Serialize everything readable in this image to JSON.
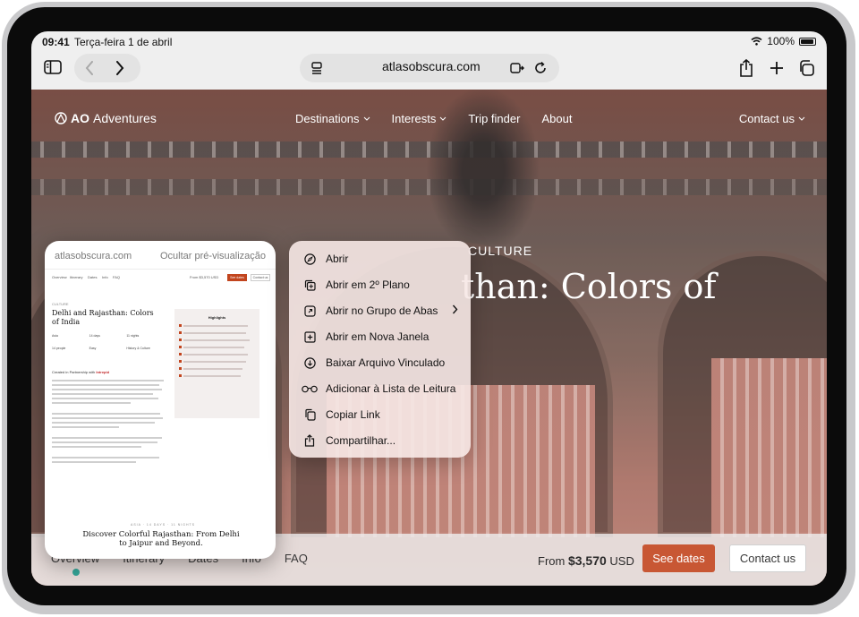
{
  "status_bar": {
    "time": "09:41",
    "date": "Terça-feira 1 de abril",
    "battery": "100%"
  },
  "toolbar": {
    "url": "atlasobscura.com",
    "icons": [
      "sidebar-icon",
      "back-icon",
      "forward-icon",
      "page-menu-icon",
      "reader-icon",
      "reload-icon",
      "share-icon",
      "new-tab-icon",
      "tabs-overview-icon"
    ]
  },
  "site": {
    "logo_bold": "AO",
    "logo_rest": "Adventures",
    "nav": [
      {
        "label": "Destinations",
        "dropdown": true
      },
      {
        "label": "Interests",
        "dropdown": true
      },
      {
        "label": "Trip finder",
        "dropdown": false
      },
      {
        "label": "About",
        "dropdown": false
      }
    ],
    "contact": "Contact us",
    "hero_kicker": "CULTURE",
    "hero_title": "than: Colors of",
    "bottom": {
      "tabs": [
        "Overview",
        "Itinerary",
        "Dates",
        "Info",
        "FAQ"
      ],
      "price_prefix": "From",
      "price_value": "$3,570",
      "price_currency": "USD",
      "see_dates": "See dates",
      "contact": "Contact us"
    }
  },
  "preview": {
    "url": "atlasobscura.com",
    "hide": "Ocultar pré-visualização",
    "nav": [
      "Overview",
      "Itinerary",
      "Dates",
      "Info",
      "FAQ"
    ],
    "price": "From $3,570 USD",
    "see_dates": "See dates",
    "contact": "Contact us",
    "kicker": "CULTURE",
    "title": "Delhi and Rajasthan: Colors of India",
    "stats": [
      "Asia",
      "14 days",
      "11 nights",
      "14 people",
      "Easy",
      "History & Culture"
    ],
    "partner_prefix": "Created in Partnership with",
    "partner_name": "Intrepid",
    "highlights_title": "Highlights",
    "footer_meta": "ASIA · 14 DAYS · 11 NIGHTS",
    "footer": "Discover Colorful Rajasthan: From Delhi to Jaipur and Beyond."
  },
  "context_menu": {
    "items": [
      {
        "label": "Abrir",
        "icon": "compass-icon",
        "submenu": false
      },
      {
        "label": "Abrir em 2º Plano",
        "icon": "background-window-icon",
        "submenu": false
      },
      {
        "label": "Abrir no Grupo de Abas",
        "icon": "tab-group-icon",
        "submenu": true
      },
      {
        "label": "Abrir em Nova Janela",
        "icon": "new-window-icon",
        "submenu": false
      },
      {
        "label": "Baixar Arquivo Vinculado",
        "icon": "download-icon",
        "submenu": false
      },
      {
        "label": "Adicionar à Lista de Leitura",
        "icon": "glasses-icon",
        "submenu": false
      },
      {
        "label": "Copiar Link",
        "icon": "copy-icon",
        "submenu": false
      },
      {
        "label": "Compartilhar...",
        "icon": "share-icon",
        "submenu": false
      }
    ]
  },
  "colors": {
    "accent": "#c2451e",
    "teal": "#1e9a8c"
  }
}
